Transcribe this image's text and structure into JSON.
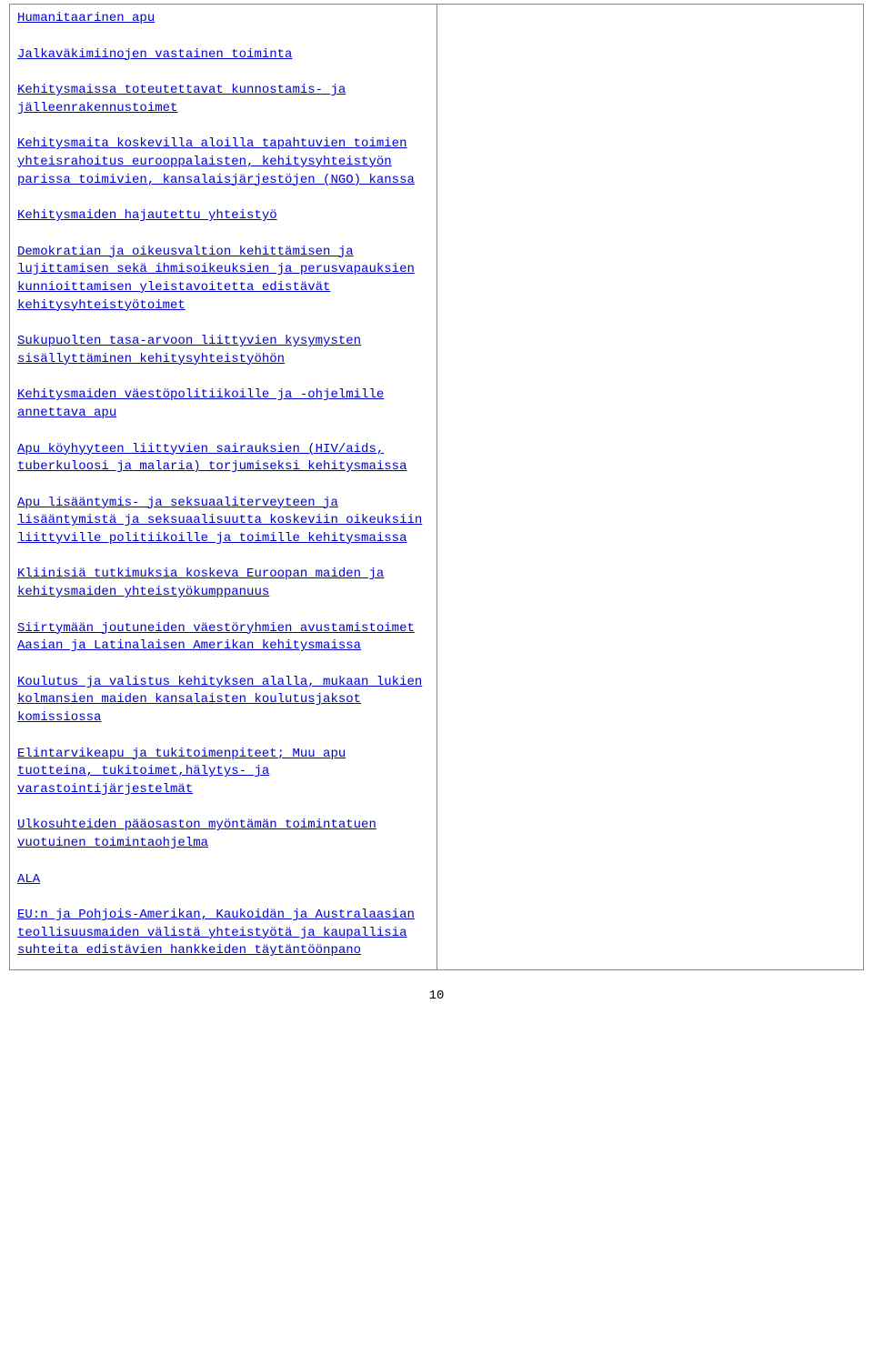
{
  "links": [
    "Humanitaarinen apu",
    "Jalkaväkimiinojen vastainen toiminta",
    "Kehitysmaissa toteutettavat kunnostamis- ja jälleenrakennustoimet",
    "Kehitysmaita koskevilla aloilla tapahtuvien toimien yhteisrahoitus eurooppalaisten, kehitysyhteistyön parissa toimivien, kansalaisjärjestöjen (NGO) kanssa",
    "Kehitysmaiden hajautettu yhteistyö",
    "Demokratian ja oikeusvaltion kehittämisen ja lujittamisen sekä ihmisoikeuksien ja perusvapauksien kunnioittamisen yleistavoitetta edistävät kehitysyhteistyötoimet",
    "Sukupuolten tasa-arvoon liittyvien kysymysten sisällyttäminen kehitysyhteistyöhön",
    "Kehitysmaiden väestöpolitiikoille ja -ohjelmille annettava apu",
    "Apu köyhyyteen liittyvien sairauksien (HIV/aids, tuberkuloosi ja malaria) torjumiseksi kehitysmaissa",
    "Apu lisääntymis- ja seksuaaliterveyteen ja lisääntymistä ja seksuaalisuutta koskeviin oikeuksiin liittyville politiikoille ja toimille kehitysmaissa",
    "Kliinisiä tutkimuksia koskeva Euroopan maiden ja kehitysmaiden yhteistyökumppanuus",
    "Siirtymään joutuneiden väestöryhmien avustamistoimet Aasian ja Latinalaisen Amerikan kehitysmaissa",
    "Koulutus ja valistus kehityksen alalla, mukaan lukien kolmansien maiden kansalaisten koulutusjaksot komissiossa",
    "Elintarvikeapu ja tukitoimenpiteet; Muu apu tuotteina, tukitoimet,hälytys- ja varastointijärjestelmät",
    "Ulkosuhteiden pääosaston myöntämän toimintatuen vuotuinen toimintaohjelma",
    "ALA",
    "EU:n ja Pohjois-Amerikan, Kaukoidän ja Australaasian teollisuusmaiden välistä yhteistyötä ja kaupallisia suhteita edistävien hankkeiden täytäntöönpano"
  ],
  "pageNumber": "10"
}
